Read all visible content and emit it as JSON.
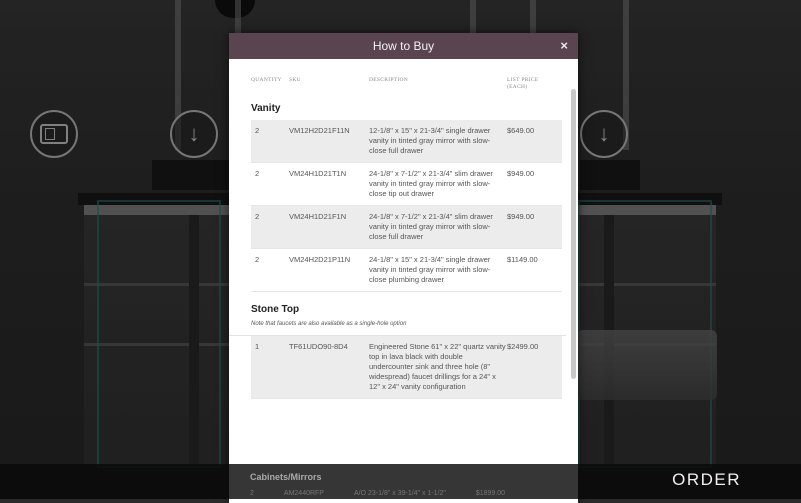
{
  "modal": {
    "title": "How to Buy",
    "close": "×",
    "columns": {
      "qty": "QUANTITY",
      "sku": "SKU",
      "desc": "DESCRIPTION",
      "price": "LIST PRICE (EACH)"
    },
    "vanity": {
      "title": "Vanity",
      "rows": [
        {
          "qty": "2",
          "sku": "VM12H2D21F11N",
          "desc": "12-1/8\" x 15\" x 21-3/4\" single drawer vanity in tinted gray mirror with slow-close full drawer",
          "price": "$649.00"
        },
        {
          "qty": "2",
          "sku": "VM24H1D21T1N",
          "desc": "24-1/8\" x 7-1/2\" x 21-3/4\" slim drawer vanity in tinted gray mirror with slow-close tip out drawer",
          "price": "$949.00"
        },
        {
          "qty": "2",
          "sku": "VM24H1D21F1N",
          "desc": "24-1/8\" x 7-1/2\" x 21-3/4\" slim drawer vanity in tinted gray mirror with slow-close full drawer",
          "price": "$949.00"
        },
        {
          "qty": "2",
          "sku": "VM24H2D21P11N",
          "desc": "24-1/8\" x 15\" x 21-3/4\" single drawer vanity in tinted gray mirror with slow-close plumbing drawer",
          "price": "$1149.00"
        }
      ]
    },
    "stone": {
      "title": "Stone Top",
      "note": "Note that faucets are also available as a single-hole option",
      "rows": [
        {
          "qty": "1",
          "sku": "TF61UDO90-8D4",
          "desc": "Engineered Stone 61\" x 22\" quartz vanity top in lava black with double undercounter sink and three hole (8\" widespread) faucet drillings for a 24\" x 12\" x 24\" vanity configuration",
          "price": "$2499.00"
        }
      ]
    },
    "cabinets": {
      "title": "Cabinets/Mirrors",
      "partial_row": {
        "qty": "2",
        "sku": "AM2440RFP",
        "desc": "A/O 23-1/8\" x 39-1/4\" x 1-1/2\"",
        "price": "$1899.00"
      }
    }
  },
  "bottom_bar": {
    "order_label": "ORDER"
  },
  "icons": {
    "left_button": "vanity-view-icon",
    "down_left": "arrow-down-icon",
    "down_right": "arrow-down-icon"
  },
  "colors": {
    "modal_header": "#5a4450",
    "outline": "#2e7f82"
  }
}
